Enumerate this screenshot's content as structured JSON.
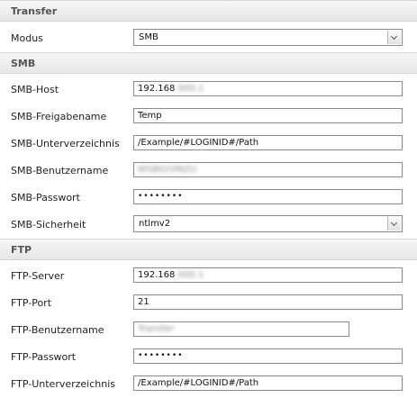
{
  "sections": {
    "transfer": {
      "title": "Transfer"
    },
    "smb": {
      "title": "SMB"
    },
    "ftp": {
      "title": "FTP"
    }
  },
  "transfer": {
    "modus": {
      "label": "Modus",
      "value": "SMB"
    }
  },
  "smb": {
    "host": {
      "label": "SMB-Host",
      "value": "192.168",
      "value_obscured": "000.1"
    },
    "share": {
      "label": "SMB-Freigabename",
      "value": "Temp"
    },
    "subdir": {
      "label": "SMB-Unterverzeichnis",
      "value": "/Example/#LOGINID#/Path"
    },
    "user": {
      "label": "SMB-Benutzername",
      "value_obscured": "WSB02\\PAZU"
    },
    "password": {
      "label": "SMB-Passwort",
      "value": "••••••••"
    },
    "security": {
      "label": "SMB-Sicherheit",
      "value": "ntlmv2"
    }
  },
  "ftp": {
    "server": {
      "label": "FTP-Server",
      "value": "192.168",
      "value_obscured": "000.1"
    },
    "port": {
      "label": "FTP-Port",
      "value": "21"
    },
    "user": {
      "label": "FTP-Benutzername",
      "value_obscured": "Transfer"
    },
    "password": {
      "label": "FTP-Passwort",
      "value": "••••••••"
    },
    "subdir": {
      "label": "FTP-Unterverzeichnis",
      "value": "/Example/#LOGINID#/Path"
    }
  },
  "icons": {
    "dropdown": "chevron-down-icon"
  }
}
